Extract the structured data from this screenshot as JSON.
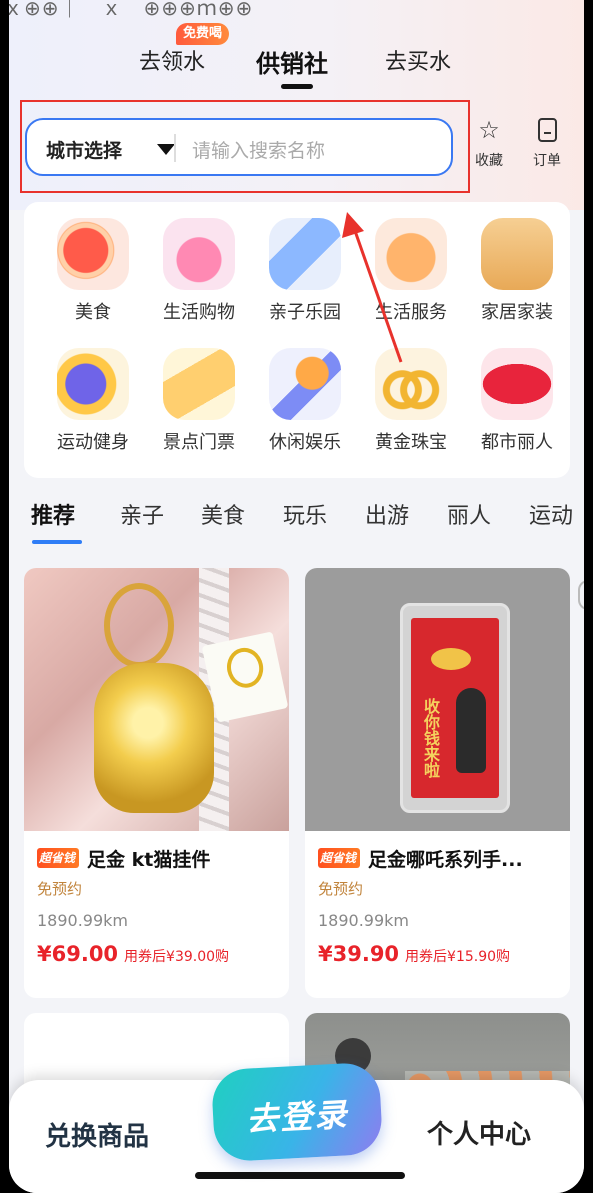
{
  "status_fragment": "ｘ⊕⊕｜　ｘ　⊕⊕⊕ｍ⊕⊕",
  "top_tabs": [
    {
      "label": "去领水"
    },
    {
      "label": "供销社"
    },
    {
      "label": "去买水"
    }
  ],
  "free_badge": "免费喝",
  "search": {
    "city_label": "城市选择",
    "placeholder": "请输入搜索名称"
  },
  "quick_actions": [
    {
      "label": "收藏",
      "icon": "star-icon"
    },
    {
      "label": "订单",
      "icon": "order-icon"
    }
  ],
  "categories": [
    {
      "label": "美食",
      "icon": "grapefruit-icon"
    },
    {
      "label": "生活购物",
      "icon": "shopping-bag-icon"
    },
    {
      "label": "亲子乐园",
      "icon": "baby-bottle-icon"
    },
    {
      "label": "生活服务",
      "icon": "wrench-icon"
    },
    {
      "label": "家居家装",
      "icon": "chair-icon"
    },
    {
      "label": "运动健身",
      "icon": "dumbbell-icon"
    },
    {
      "label": "景点门票",
      "icon": "ticket-icon"
    },
    {
      "label": "休闲娱乐",
      "icon": "microphone-icon"
    },
    {
      "label": "黄金珠宝",
      "icon": "rings-icon"
    },
    {
      "label": "都市丽人",
      "icon": "lips-icon"
    }
  ],
  "category_tabs": [
    {
      "label": "推荐",
      "active": true
    },
    {
      "label": "亲子"
    },
    {
      "label": "美食"
    },
    {
      "label": "玩乐"
    },
    {
      "label": "出游"
    },
    {
      "label": "丽人"
    },
    {
      "label": "运动"
    }
  ],
  "products": [
    {
      "badge": "超省钱",
      "name": "足金 kt猫挂件",
      "tag": "免预约",
      "distance": "1890.99km",
      "price": "¥69.00",
      "coupon_price": "用券后¥39.00购"
    },
    {
      "badge": "超省钱",
      "name": "足金哪吒系列手...",
      "tag": "免预约",
      "distance": "1890.99km",
      "price": "¥39.90",
      "coupon_price": "用券后¥15.90购",
      "image_text": "收你钱来啦"
    }
  ],
  "bottom_nav": {
    "left": "兑换商品",
    "center": "去登录",
    "right": "个人中心"
  },
  "colors": {
    "accent_blue": "#3a78f2",
    "price_red": "#e8232a",
    "annotation_red": "#e8322c"
  }
}
